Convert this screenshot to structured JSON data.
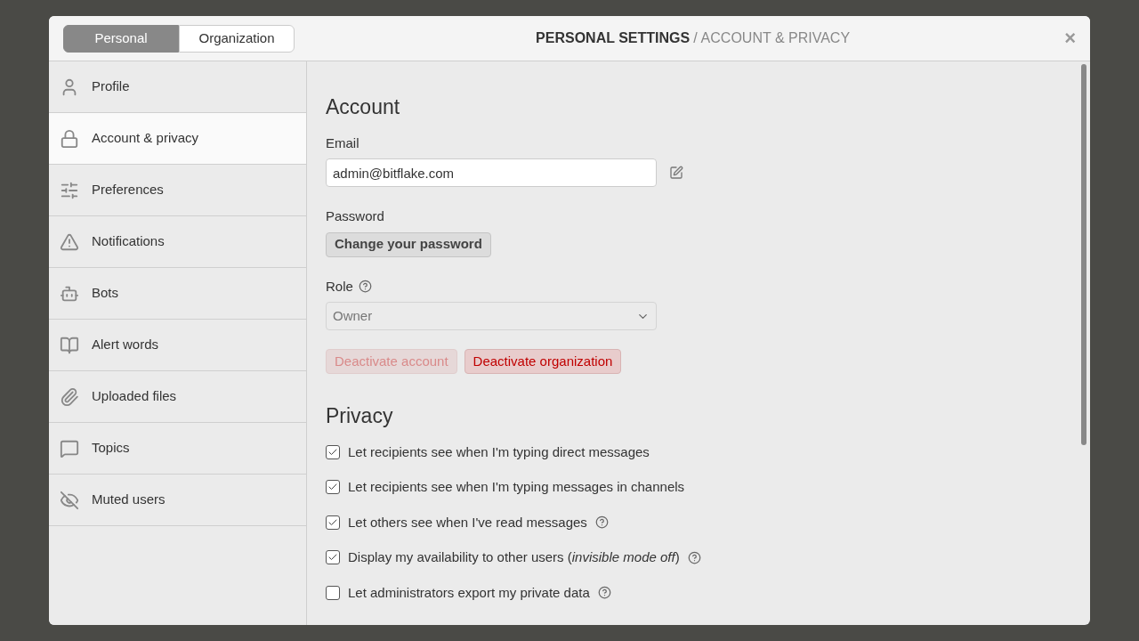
{
  "modal": {
    "tabs": [
      {
        "label": "Personal",
        "selected": true
      },
      {
        "label": "Organization",
        "selected": false
      }
    ],
    "title": {
      "section": "PERSONAL SETTINGS",
      "separator": "/",
      "page": "ACCOUNT & PRIVACY"
    },
    "close": "×"
  },
  "sidebar": {
    "items": [
      {
        "label": "Profile",
        "kind": "person",
        "selected": false
      },
      {
        "label": "Account & privacy",
        "kind": "lock",
        "selected": true
      },
      {
        "label": "Preferences",
        "kind": "sliders",
        "selected": false
      },
      {
        "label": "Notifications",
        "kind": "warning",
        "selected": false
      },
      {
        "label": "Bots",
        "kind": "robot",
        "selected": false
      },
      {
        "label": "Alert words",
        "kind": "book",
        "selected": false
      },
      {
        "label": "Uploaded files",
        "kind": "paperclip",
        "selected": false
      },
      {
        "label": "Topics",
        "kind": "speech",
        "selected": false
      },
      {
        "label": "Muted users",
        "kind": "eye-off",
        "selected": false
      }
    ]
  },
  "account": {
    "heading": "Account",
    "email_label": "Email",
    "email_value": "admin@bitflake.com",
    "password_label": "Password",
    "password_button": "Change your password",
    "role_label": "Role",
    "role_value": "Owner",
    "role_disabled": true,
    "buttons": [
      {
        "label": "Deactivate account",
        "disabled": true
      },
      {
        "label": "Deactivate organization",
        "disabled": false
      }
    ]
  },
  "privacy": {
    "heading": "Privacy",
    "options": [
      {
        "label": "Let recipients see when I'm typing direct messages",
        "checked": true,
        "help": false
      },
      {
        "label": "Let recipients see when I'm typing messages in channels",
        "checked": true,
        "help": false
      },
      {
        "label": "Let others see when I've read messages",
        "checked": true,
        "help": true
      },
      {
        "label": "Display my availability to other users (*invisible mode off*)",
        "checked": true,
        "help": true
      },
      {
        "label": "Let administrators export my private data",
        "checked": false,
        "help": true
      }
    ]
  }
}
